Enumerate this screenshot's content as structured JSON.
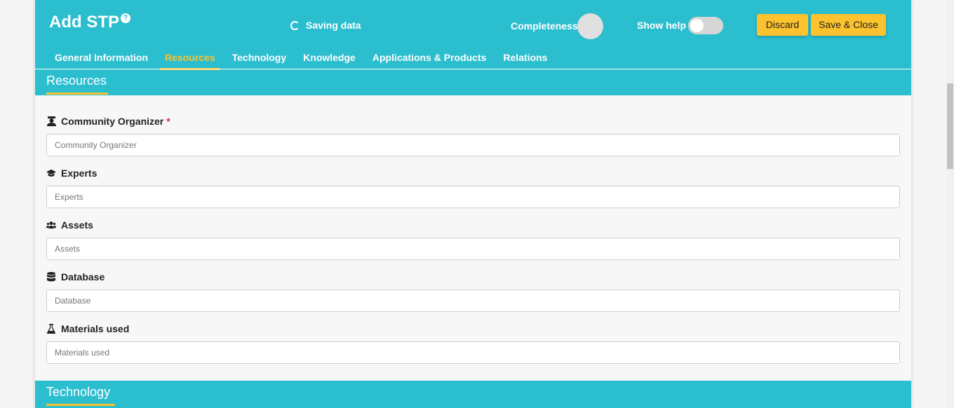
{
  "header": {
    "title": "Add STP",
    "help_icon": "?",
    "saving_text": "Saving data",
    "completeness_label": "Completeness",
    "show_help_label": "Show help",
    "show_help_enabled": false,
    "discard_label": "Discard",
    "save_close_label": "Save & Close"
  },
  "tabs": [
    {
      "label": "General Information",
      "active": false
    },
    {
      "label": "Resources",
      "active": true
    },
    {
      "label": "Technology",
      "active": false
    },
    {
      "label": "Knowledge",
      "active": false
    },
    {
      "label": "Applications & Products",
      "active": false
    },
    {
      "label": "Relations",
      "active": false
    }
  ],
  "resources": {
    "title": "Resources",
    "fields": [
      {
        "label": "Community Organizer",
        "required": true,
        "placeholder": "Community Organizer",
        "icon": "user-graduate-icon"
      },
      {
        "label": "Experts",
        "required": false,
        "placeholder": "Experts",
        "icon": "graduation-cap-icon"
      },
      {
        "label": "Assets",
        "required": false,
        "placeholder": "Assets",
        "icon": "users-icon"
      },
      {
        "label": "Database",
        "required": false,
        "placeholder": "Database",
        "icon": "database-icon"
      },
      {
        "label": "Materials used",
        "required": false,
        "placeholder": "Materials used",
        "icon": "flask-icon"
      }
    ]
  },
  "next_section": {
    "title": "Technology"
  },
  "colors": {
    "primary": "#2bbecf",
    "accent": "#fcc32e"
  }
}
